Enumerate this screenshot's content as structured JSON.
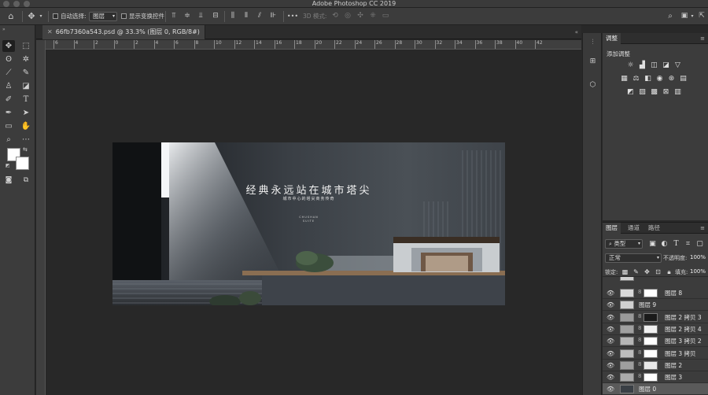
{
  "window": {
    "title": "Adobe Photoshop CC 2019"
  },
  "options_bar": {
    "auto_select_label": "自动选择:",
    "auto_select_value": "图层",
    "show_transform_label": "显示变换控件",
    "mode_3d_label": "3D 模式:",
    "more_label": "•••"
  },
  "document": {
    "tab_title": "66fb7360a543.psd @ 33.3% (图层 0, RGB/8#)",
    "zoom": "33.3%",
    "ruler_marks": [
      "6",
      "4",
      "2",
      "0",
      "2",
      "4",
      "6",
      "8",
      "10",
      "12",
      "14",
      "16",
      "18",
      "20",
      "22",
      "24",
      "26",
      "28",
      "30",
      "32",
      "34",
      "36",
      "38",
      "40",
      "42"
    ]
  },
  "artwork": {
    "headline": "经典永远站在城市塔尖",
    "subline": "城市中心的塔尖商务传奇",
    "logo_line1": "CHUSHAN",
    "logo_line2": "SUITE"
  },
  "adjustments_panel": {
    "tab": "调整",
    "add_label": "添加调整"
  },
  "layers_panel": {
    "tabs": [
      "图层",
      "通道",
      "路径"
    ],
    "filter_kind": "类型",
    "blend_mode": "正常",
    "opacity_label": "不透明度:",
    "opacity_value": "100%",
    "lock_label": "锁定:",
    "fill_label": "填充:",
    "fill_value": "100%",
    "layers": [
      {
        "name": "图层 8"
      },
      {
        "name": "图层 9"
      },
      {
        "name": "图层 2 拷贝 3"
      },
      {
        "name": "图层 2 拷贝 4"
      },
      {
        "name": "图层 3 拷贝 2"
      },
      {
        "name": "图层 3 拷贝"
      },
      {
        "name": "图层 2"
      },
      {
        "name": "图层 3"
      },
      {
        "name": "图层 0"
      }
    ]
  },
  "colors": {
    "panel_bg": "#3c3c3c",
    "pasteboard": "#282828",
    "selected_layer": "#5a5a5a"
  }
}
